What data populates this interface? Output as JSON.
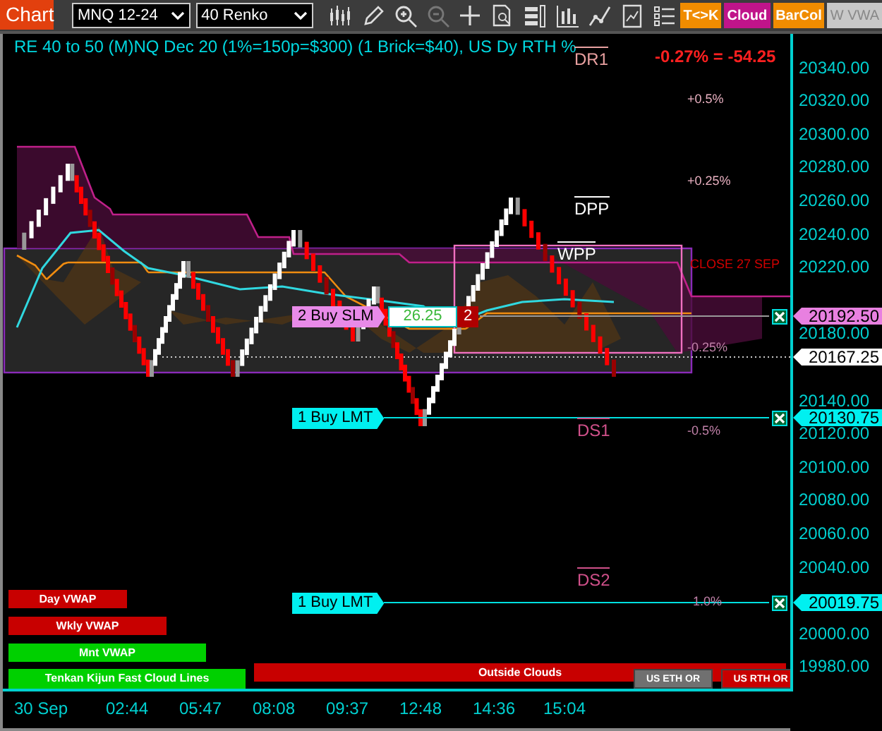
{
  "toolbar": {
    "title": "Chart",
    "instrument": "MNQ 12-24",
    "bar_type": "40 Renko",
    "toggles": [
      {
        "label": "T<>K",
        "color": "#f08c00"
      },
      {
        "label": "Cloud",
        "color": "#c0148a"
      },
      {
        "label": "BarCol",
        "color": "#f08c00"
      },
      {
        "label": "W VWA",
        "color": "#c8c8c8"
      }
    ]
  },
  "chart": {
    "header": "RE 40 to 50 (M)NQ Dec 20 (1%=150p=$300) (1 Brick=$40), US Dy RTH %",
    "change": "-0.27% = -54.25",
    "levels": [
      {
        "label": "DR1",
        "color": "#e8a0a0"
      },
      {
        "label": "DPP",
        "color": "#ffffff"
      },
      {
        "label": "WPP",
        "color": "#ffffff"
      },
      {
        "label": "DS1",
        "color": "#d0508a"
      },
      {
        "label": "DS2",
        "color": "#d0508a"
      }
    ],
    "percent_marks": [
      {
        "label": "+0.5%",
        "color": "#e8b0c0"
      },
      {
        "label": "+0.25%",
        "color": "#e8b0c0"
      },
      {
        "label": "CLOSE 27 SEP",
        "color": "#d00000"
      },
      {
        "label": "-0.25%",
        "color": "#c080a8"
      },
      {
        "label": "-0.5%",
        "color": "#c080a8"
      },
      {
        "label": "1.0%",
        "color": "#c080a8"
      }
    ],
    "orders": [
      {
        "kind": "stop",
        "label": "2 Buy SLM",
        "value": "26.25",
        "quantity": "2"
      },
      {
        "kind": "limit",
        "label": "1 Buy LMT"
      },
      {
        "kind": "limit",
        "label": "1 Buy LMT"
      }
    ],
    "indicator_bars": [
      {
        "label": "Day VWAP",
        "color": "#c80000"
      },
      {
        "label": "Wkly VWAP",
        "color": "#c80000"
      },
      {
        "label": "Mnt VWAP",
        "color": "#00d000"
      },
      {
        "label": "Tenkan Kijun Fast Cloud Lines",
        "color": "#00d000"
      },
      {
        "label": "Outside Clouds",
        "color": "#c80000"
      },
      {
        "label": "US ETH OR",
        "color": "#707070"
      },
      {
        "label": "US RTH OR",
        "color": "#c80000"
      }
    ]
  },
  "price_axis": {
    "labels": [
      "20340.00",
      "20320.00",
      "20300.00",
      "20280.00",
      "20260.00",
      "20240.00",
      "20220.00",
      "20180.00",
      "20140.00",
      "20120.00",
      "20100.00",
      "20080.00",
      "20060.00",
      "20040.00",
      "20000.00",
      "19980.00"
    ],
    "tags": [
      {
        "label": "20192.50",
        "color": "#e880e0"
      },
      {
        "label": "20167.25",
        "color": "#ffffff"
      },
      {
        "label": "20130.75",
        "color": "#00f0f0"
      },
      {
        "label": "20019.75",
        "color": "#00f0f0"
      }
    ]
  },
  "time_axis": {
    "labels": [
      "30 Sep",
      "02:44",
      "05:47",
      "08:08",
      "09:37",
      "12:48",
      "14:36",
      "15:04"
    ]
  }
}
